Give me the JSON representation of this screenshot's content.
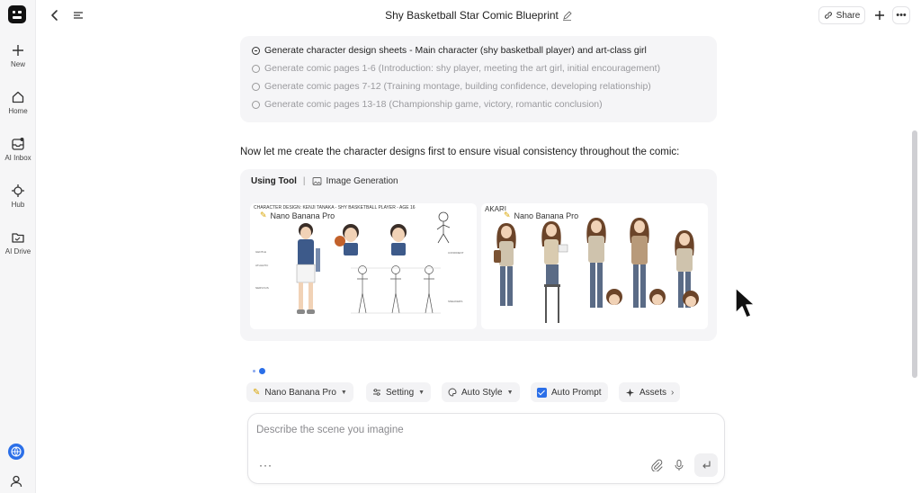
{
  "sidebar": {
    "items": [
      {
        "label": "New",
        "icon": "plus-icon"
      },
      {
        "label": "Home",
        "icon": "home-icon"
      },
      {
        "label": "AI Inbox",
        "icon": "inbox-icon"
      },
      {
        "label": "Hub",
        "icon": "hub-icon"
      },
      {
        "label": "AI Drive",
        "icon": "folder-icon"
      }
    ]
  },
  "header": {
    "title": "Shy Basketball Star Comic Blueprint",
    "share_label": "Share"
  },
  "plan": {
    "items": [
      {
        "text": "Generate character design sheets - Main character (shy basketball player) and art-class girl",
        "status": "in-progress"
      },
      {
        "text": "Generate comic pages 1-6 (Introduction: shy player, meeting the art girl, initial encouragement)",
        "status": "pending"
      },
      {
        "text": "Generate comic pages 7-12 (Training montage, building confidence, developing relationship)",
        "status": "pending"
      },
      {
        "text": "Generate comic pages 13-18 (Championship game, victory, romantic conclusion)",
        "status": "pending"
      }
    ]
  },
  "message": "Now let me create the character designs first to ensure visual consistency throughout the comic:",
  "tool": {
    "using_label": "Using Tool",
    "separator": "|",
    "name": "Image Generation",
    "images": [
      {
        "model": "Nano Banana Pro",
        "caption": "CHARACTER DESIGN: KENJI TANAKA - SHY BASKETBALL PLAYER - AGE 16"
      },
      {
        "model": "Nano Banana Pro",
        "caption": "AKARI"
      }
    ]
  },
  "options": {
    "model": "Nano Banana Pro",
    "setting": "Setting",
    "style": "Auto Style",
    "auto_prompt": "Auto Prompt",
    "auto_prompt_checked": true,
    "assets": "Assets"
  },
  "prompt": {
    "placeholder": "Describe the scene you imagine",
    "value": "",
    "more": "···"
  },
  "colors": {
    "accent": "#2b6fe8",
    "card_bg": "#f5f5f7",
    "sidebar_bg": "#f6f6f7"
  }
}
